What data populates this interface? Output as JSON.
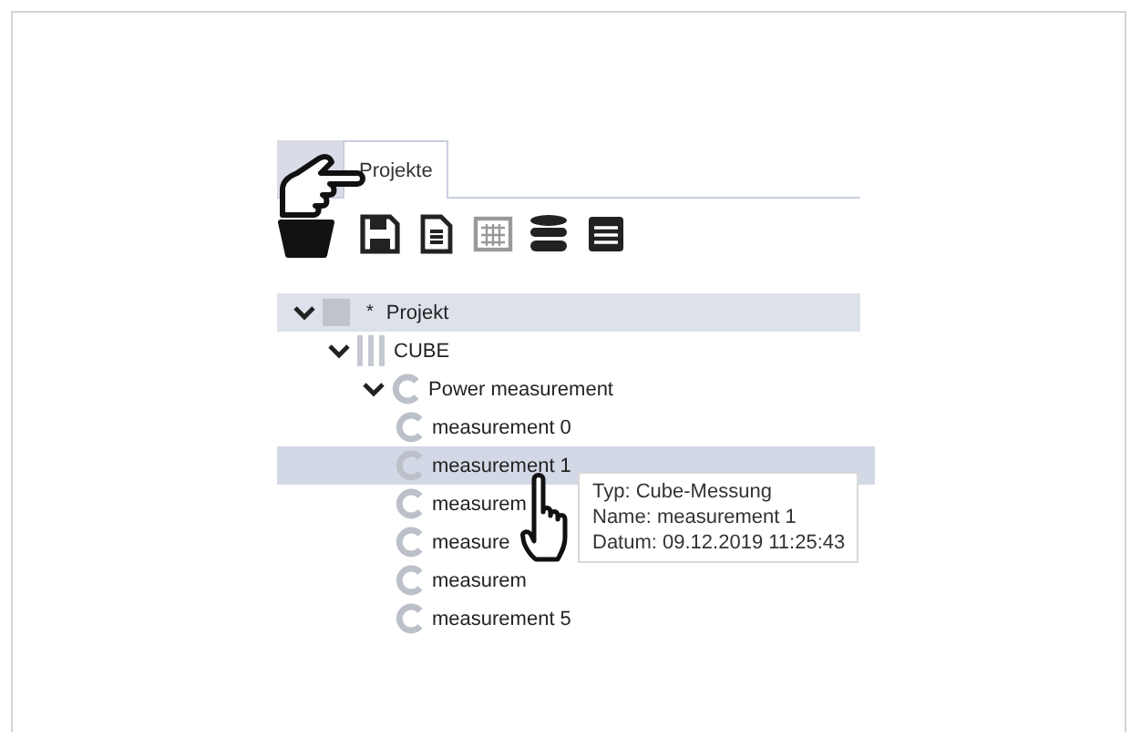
{
  "tabs": [
    {
      "label": "Projekte",
      "selected": true
    }
  ],
  "toolbar": [
    {
      "kind": "save"
    },
    {
      "kind": "document"
    },
    {
      "kind": "table",
      "disabled": true
    },
    {
      "kind": "database"
    },
    {
      "kind": "list"
    }
  ],
  "tree": [
    {
      "label": "Projekt",
      "kind": "project",
      "marker": "*",
      "expanded": true,
      "selected": false,
      "highlighted": true,
      "children": [
        {
          "label": "CUBE",
          "kind": "cube",
          "expanded": true,
          "selected": false,
          "highlighted": false,
          "children": [
            {
              "label": "Power measurement",
              "kind": "measurement",
              "expanded": true,
              "selected": false,
              "highlighted": false,
              "children": [
                {
                  "label": "measurement 0",
                  "kind": "measurement",
                  "selected": false,
                  "highlighted": false
                },
                {
                  "label": "measurement 1",
                  "kind": "measurement",
                  "selected": true,
                  "highlighted": false
                },
                {
                  "label": "measurem",
                  "kind": "measurement",
                  "selected": false,
                  "highlighted": false
                },
                {
                  "label": "measure",
                  "kind": "measurement",
                  "selected": false,
                  "highlighted": false
                },
                {
                  "label": "measurem",
                  "kind": "measurement",
                  "selected": false,
                  "highlighted": false
                },
                {
                  "label": "measurement 5",
                  "kind": "measurement",
                  "selected": false,
                  "highlighted": false
                }
              ]
            }
          ]
        }
      ]
    }
  ],
  "tooltip": [
    "Typ: Cube-Messung",
    "Name: measurement 1",
    "Datum: 09.12.2019 11:25:43"
  ]
}
